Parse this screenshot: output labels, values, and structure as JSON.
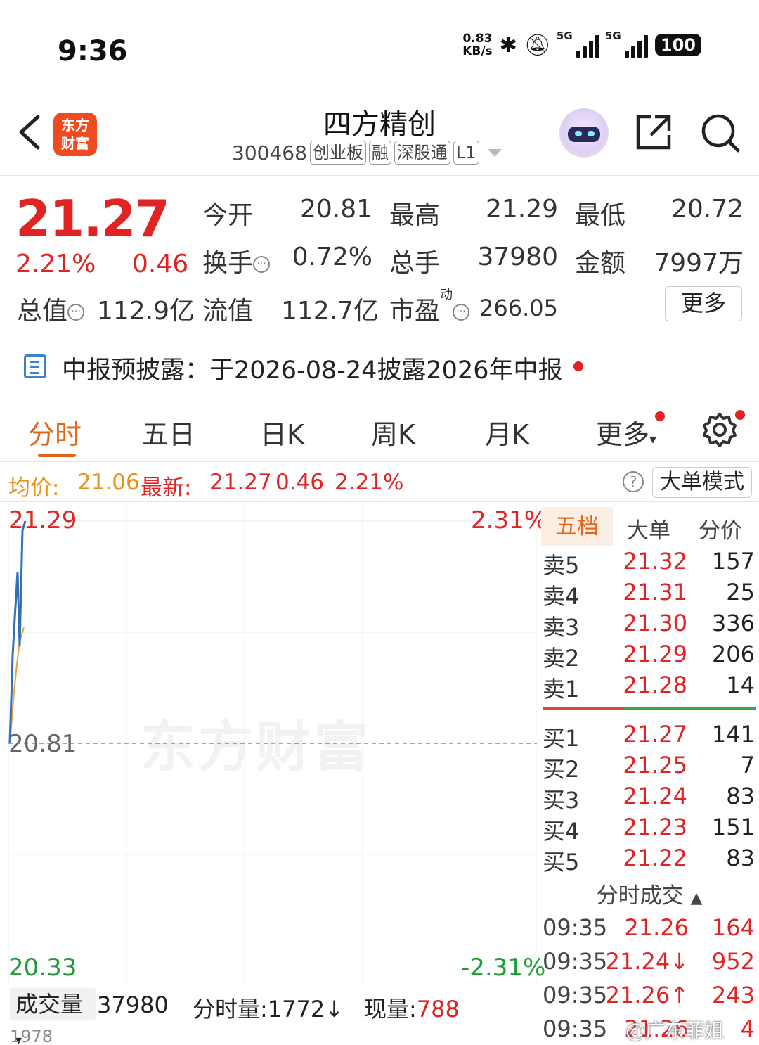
{
  "status_bar": {
    "time": "9:36",
    "speed_value": "0.83",
    "speed_unit": "KB/s",
    "signal1": "5G",
    "signal2": "5G",
    "battery": "100"
  },
  "header": {
    "logo_line1": "东方",
    "logo_line2": "财富",
    "stock_name": "四方精创",
    "stock_code": "300468",
    "tags": [
      "创业板",
      "融",
      "深股通",
      "L1"
    ]
  },
  "quote": {
    "price": "21.27",
    "change_pct": "2.21%",
    "change": "0.46",
    "fields": {
      "open_label": "今开",
      "open": "20.81",
      "high_label": "最高",
      "high": "21.29",
      "low_label": "最低",
      "low": "20.72",
      "turnover_label": "换手",
      "turnover": "0.72%",
      "volume_label": "总手",
      "volume": "37980",
      "amount_label": "金额",
      "amount": "7997万",
      "mktcap_label": "总值",
      "mktcap": "112.9亿",
      "float_label": "流值",
      "float": "112.7亿",
      "pe_label": "市盈",
      "pe_sup": "动",
      "pe": "266.05"
    },
    "more_label": "更多",
    "colors": {
      "up": "#e02424",
      "down": "#1f9d3a"
    }
  },
  "notice": {
    "text": "中报预披露：于2026-08-24披露2026年中报"
  },
  "tabs": [
    "分时",
    "五日",
    "日K",
    "周K",
    "月K",
    "更多"
  ],
  "avg_line": {
    "avg_label": "均价:",
    "avg": "21.06",
    "latest_label": "最新:",
    "latest": "21.27",
    "change": "0.46",
    "pct": "2.21%",
    "big_mode": "大单模式"
  },
  "chart": {
    "top_price": "21.29",
    "top_pct": "2.31%",
    "mid_price": "20.81",
    "bottom_price": "20.33",
    "bottom_pct": "-2.31%",
    "watermark": "东方财富"
  },
  "chart_data": {
    "type": "line",
    "ylim": [
      20.33,
      21.29
    ],
    "reference": 20.81,
    "series": [
      {
        "values": [
          20.81,
          21.0,
          21.08,
          21.18,
          21.02,
          21.27,
          21.29
        ]
      },
      {
        "values": [
          20.81,
          20.92,
          20.98,
          21.03,
          21.06
        ]
      }
    ]
  },
  "order_book": {
    "tabs": [
      "五档",
      "大单",
      "分价"
    ],
    "asks": [
      {
        "name": "卖5",
        "price": "21.32",
        "vol": "157"
      },
      {
        "name": "卖4",
        "price": "21.31",
        "vol": "25"
      },
      {
        "name": "卖3",
        "price": "21.30",
        "vol": "336"
      },
      {
        "name": "卖2",
        "price": "21.29",
        "vol": "206"
      },
      {
        "name": "卖1",
        "price": "21.28",
        "vol": "14"
      }
    ],
    "bids": [
      {
        "name": "买1",
        "price": "21.27",
        "vol": "141"
      },
      {
        "name": "买2",
        "price": "21.25",
        "vol": "7"
      },
      {
        "name": "买3",
        "price": "21.24",
        "vol": "83"
      },
      {
        "name": "买4",
        "price": "21.23",
        "vol": "151"
      },
      {
        "name": "买5",
        "price": "21.22",
        "vol": "83"
      }
    ]
  },
  "ticks": {
    "header": "分时成交",
    "rows": [
      {
        "time": "09:35",
        "price": "21.26",
        "vol": "164"
      },
      {
        "time": "09:35",
        "price": "21.24↓",
        "vol": "952"
      },
      {
        "time": "09:35",
        "price": "21.26↑",
        "vol": "243"
      },
      {
        "time": "09:35",
        "price": "21.26",
        "vol": "4"
      }
    ]
  },
  "volume": {
    "selector": "成交量",
    "total": "37980",
    "minute_label": "分时量:1772↓",
    "now_label": "现量:",
    "now": "788",
    "axis_max": "1978"
  },
  "watermark_weibo": "@广东菲姐"
}
